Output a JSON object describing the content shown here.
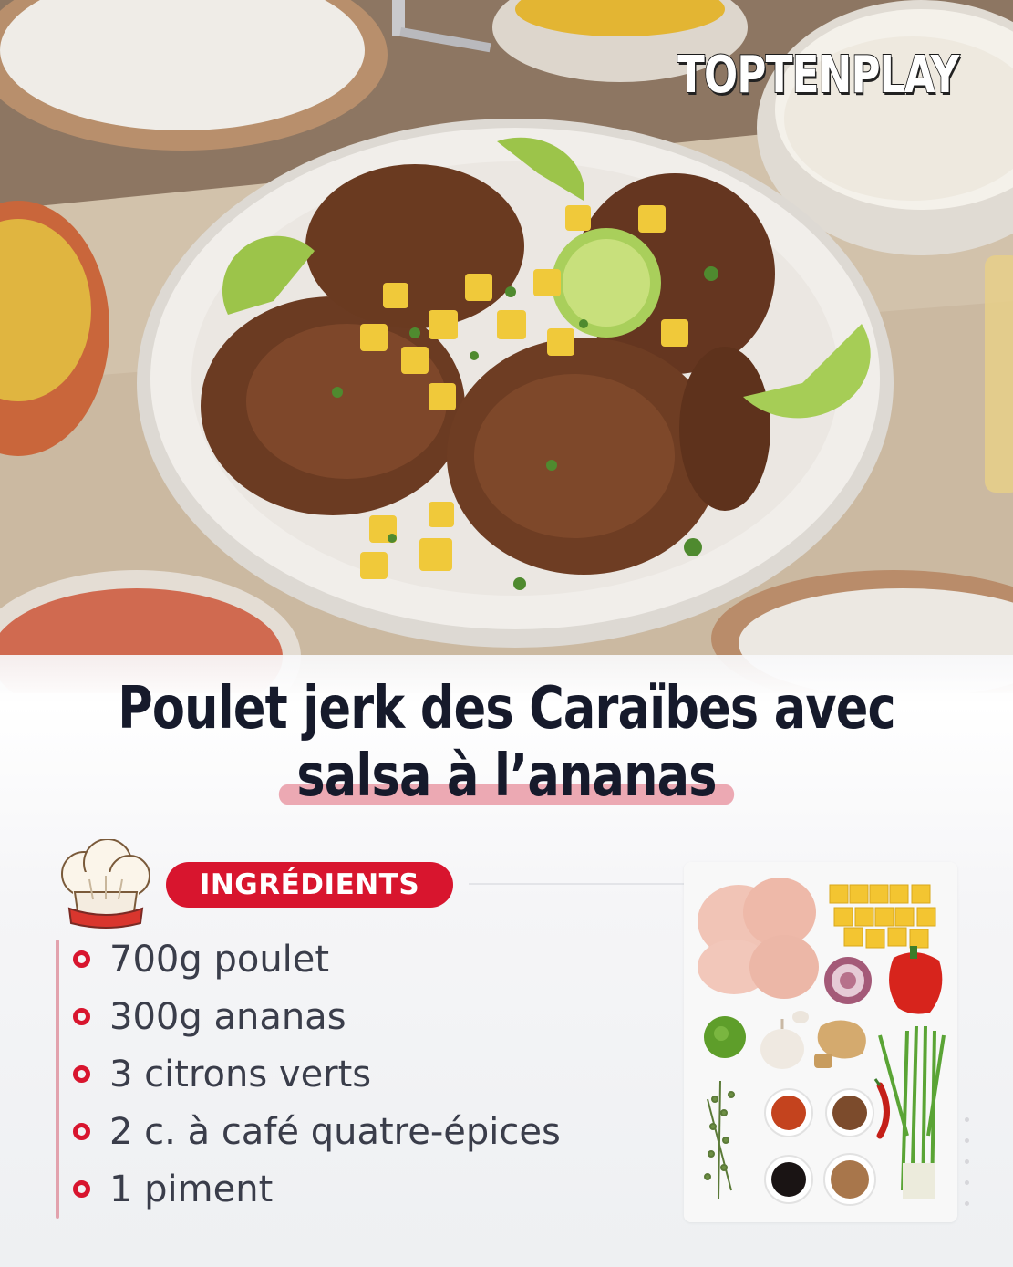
{
  "brand": {
    "watermark": "TOPTENPLAY"
  },
  "recipe": {
    "title_line1": "Poulet jerk des Caraïbes avec",
    "title_line2": "salsa à l’ananas"
  },
  "ingredients": {
    "header_label": "INGRÉDIENTS",
    "items": [
      {
        "text": "700g poulet"
      },
      {
        "text": "300g ananas"
      },
      {
        "text": "3 citrons verts"
      },
      {
        "text": "2 c. à café quatre-épices"
      },
      {
        "text": "1 piment"
      }
    ]
  },
  "colors": {
    "accent": "#d8152e",
    "title": "#161a2b",
    "highlight": "#e99aa6",
    "body_text": "#3a3d4a"
  }
}
